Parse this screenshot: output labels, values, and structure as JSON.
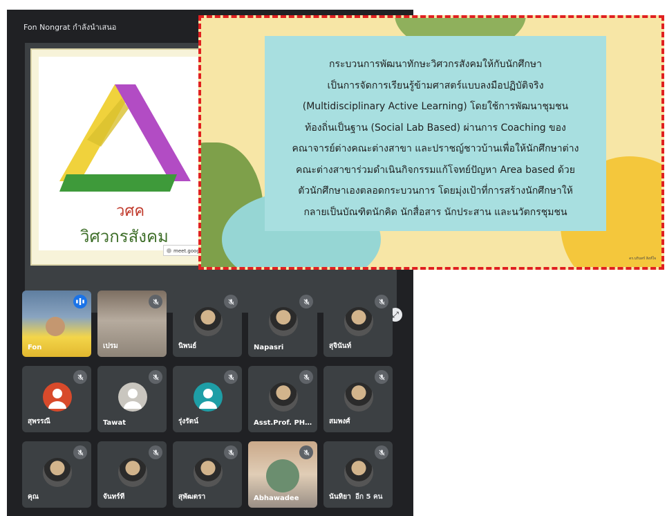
{
  "meeting": {
    "presenter_label": "Fon Nongrat กำลังนำเสนอ",
    "url_tooltip": "meet.google.com is sharing"
  },
  "slide": {
    "logo_short": "วศค",
    "logo_full": "วิศวกรสังคม"
  },
  "overlay": {
    "lines": [
      "กระบวนการพัฒนาทักษะวิศวกรสังคมให้กับนักศึกษา",
      "เป็นการจัดการเรียนรู้ข้ามศาสตร์แบบลงมือปฏิบัติจริง",
      "(Multidisciplinary Active Learning) โดยใช้การพัฒนาชุมชน",
      "ท้องถิ่นเป็นฐาน (Social Lab Based) ผ่านการ Coaching ของ",
      "คณาจารย์ต่างคณะต่างสาขา และปราชญ์ชาวบ้านเพื่อให้นักศึกษาต่าง",
      "คณะต่างสาขาร่วมดำเนินกิจกรรมแก้โจทย์ปัญหา Area based ด้วย",
      "ตัวนักศึกษาเองตลอดกระบวนการ โดยมุ่งเป้าที่การสร้างนักศึกษาให้",
      "กลายเป็นบัณฑิตนักคิด นักสื่อสาร นักประสาน และนวัตกรชุมชน"
    ],
    "credit": "ดร.นรินทร์ สิงห์ใจ"
  },
  "participants": [
    {
      "name": "Fon",
      "type": "video-fon",
      "speaking": true
    },
    {
      "name": "เปรม",
      "type": "video-pram",
      "muted": true
    },
    {
      "name": "นิพนธ์",
      "type": "photo",
      "muted": true
    },
    {
      "name": "Napasri",
      "type": "photo",
      "muted": true
    },
    {
      "name": "สุจินันท์",
      "type": "photo",
      "muted": true
    },
    {
      "name": "สุพรรณี",
      "type": "generic",
      "color": "#d84a2b",
      "muted": true
    },
    {
      "name": "Tawat",
      "type": "generic",
      "color": "#c9c6bf",
      "muted": true
    },
    {
      "name": "รุ่งรัตน์",
      "type": "generic",
      "color": "#1e9ea6",
      "muted": true
    },
    {
      "name": "Asst.Prof. PHU...",
      "type": "photo",
      "muted": true
    },
    {
      "name": "สมพงศ์",
      "type": "photo",
      "muted": true
    },
    {
      "name": "คุณ",
      "type": "photo",
      "muted": true
    },
    {
      "name": "จันทร์ที",
      "type": "photo",
      "muted": true
    },
    {
      "name": "สุพัฒตรา",
      "type": "photo",
      "muted": true
    },
    {
      "name": "Abhawadee",
      "type": "video-abh",
      "muted": true
    },
    {
      "name": "นันทิยา",
      "type": "photo",
      "muted": true
    }
  ],
  "more_label": "อีก 5 คน"
}
